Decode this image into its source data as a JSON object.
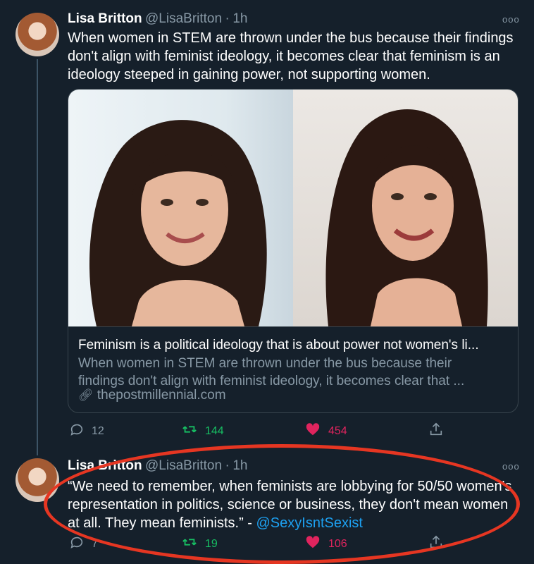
{
  "tweet1": {
    "name": "Lisa Britton",
    "handle": "@LisaBritton",
    "sep": "·",
    "time": "1h",
    "text": "When women in STEM are thrown under the bus because their findings don't align with feminist ideology, it becomes clear that feminism is an ideology steeped in gaining power, not supporting women.",
    "card": {
      "title": "Feminism is a political ideology that is about power not women's li...",
      "description": "When women in STEM are thrown under the bus because their findings don't align with feminist ideology, it becomes clear that ...",
      "link": "thepostmillennial.com"
    },
    "actions": {
      "replies": "12",
      "retweets": "144",
      "likes": "454"
    }
  },
  "tweet2": {
    "name": "Lisa Britton",
    "handle": "@LisaBritton",
    "sep": "·",
    "time": "1h",
    "text_main": "“We need to remember, when feminists are lobbying for 50/50 women's representation in politics, science or business, they don't mean women at all. They mean feminists.” - ",
    "mention": "@SexyIsntSexist",
    "actions": {
      "replies": "7",
      "retweets": "19",
      "likes": "106"
    }
  },
  "colors": {
    "background": "#15202b",
    "secondary_text": "#8899a6",
    "retweet": "#17bf63",
    "like": "#e0245e",
    "mention": "#1da1f2",
    "annotation": "#e63622"
  },
  "icons": [
    "more-icon",
    "reply-icon",
    "retweet-icon",
    "like-icon",
    "share-icon",
    "link-icon"
  ]
}
